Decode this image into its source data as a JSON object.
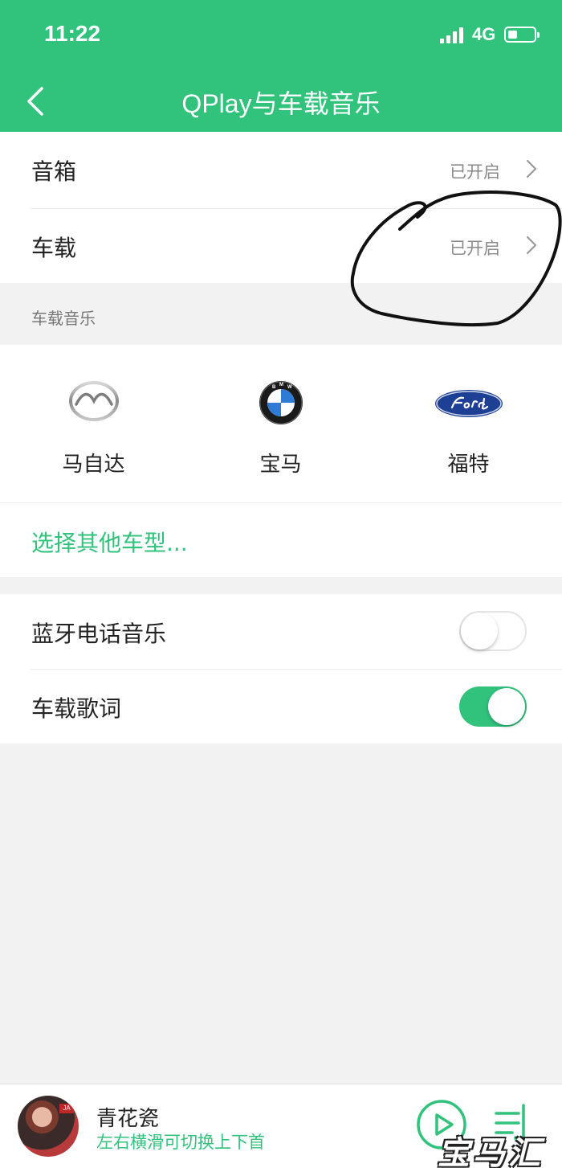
{
  "status_bar": {
    "time": "11:22",
    "network": "4G",
    "battery_level": 0.35
  },
  "nav": {
    "title": "QPlay与车载音乐"
  },
  "settings": {
    "speaker": {
      "label": "音箱",
      "value": "已开启"
    },
    "car": {
      "label": "车载",
      "value": "已开启"
    }
  },
  "car_music": {
    "header": "车载音乐",
    "brands": [
      {
        "name": "马自达",
        "icon": "mazda-logo-icon"
      },
      {
        "name": "宝马",
        "icon": "bmw-logo-icon"
      },
      {
        "name": "福特",
        "icon": "ford-logo-icon"
      }
    ],
    "more_link": "选择其他车型..."
  },
  "toggles": {
    "bluetooth_music": {
      "label": "蓝牙电话音乐",
      "on": false
    },
    "car_lyrics": {
      "label": "车载歌词",
      "on": true
    }
  },
  "player": {
    "song_title": "青花瓷",
    "hint": "左右横滑可切换上下首",
    "avatar_tag": "JA"
  },
  "watermark": "宝马汇",
  "colors": {
    "accent": "#31c27c",
    "background": "#f2f2f2"
  }
}
